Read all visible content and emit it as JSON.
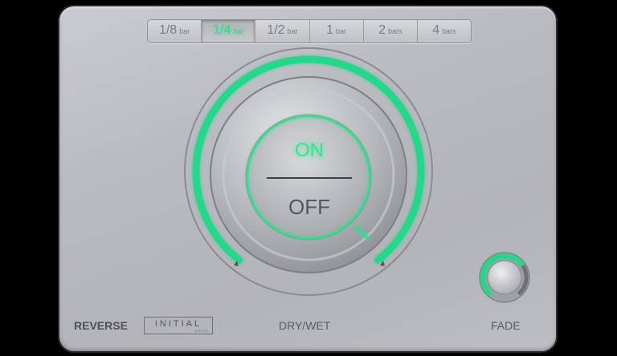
{
  "tabs": [
    {
      "value": "1/8",
      "unit": "bar",
      "active": false
    },
    {
      "value": "1/4",
      "unit": "bar",
      "active": true
    },
    {
      "value": "1/2",
      "unit": "bar",
      "active": false
    },
    {
      "value": "1",
      "unit": "bar",
      "active": false
    },
    {
      "value": "2",
      "unit": "bars",
      "active": false
    },
    {
      "value": "4",
      "unit": "bars",
      "active": false
    }
  ],
  "switch": {
    "on_label": "ON",
    "off_label": "OFF",
    "state": "on"
  },
  "labels": {
    "reverse": "REVERSE",
    "drywet": "DRY/WET",
    "fade": "FADE"
  },
  "logo": {
    "text": "INITIAL",
    "subtext": "AUDIO"
  },
  "drywet_level": 1.0,
  "fade_level": 0.7,
  "colors": {
    "accent": "#2fd98a",
    "panel": "#bfc1c6",
    "text": "#5a5c62"
  }
}
